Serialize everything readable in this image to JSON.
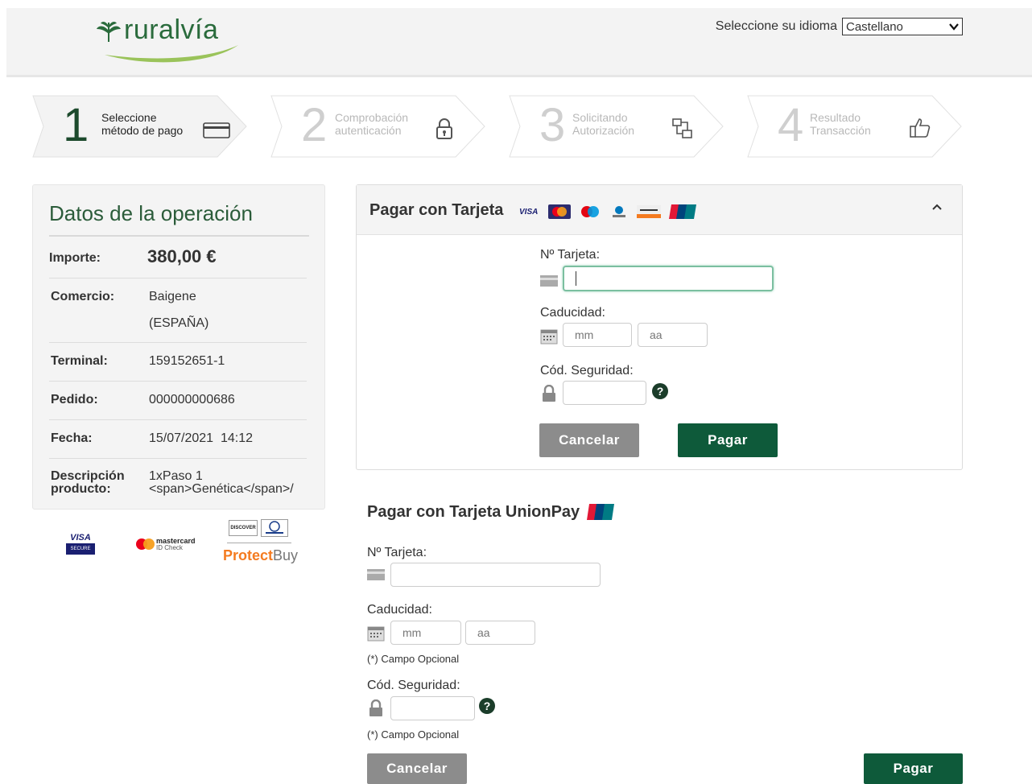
{
  "header": {
    "brand": "ruralvía",
    "language_label": "Seleccione su idioma",
    "language_selected": "Castellano"
  },
  "steps": [
    {
      "number": "1",
      "line1": "Seleccione",
      "line2": "método de pago",
      "icon": "credit-card-icon",
      "active": true
    },
    {
      "number": "2",
      "line1": "Comprobación",
      "line2": "autenticación",
      "icon": "lock-icon",
      "active": false
    },
    {
      "number": "3",
      "line1": "Solicitando",
      "line2": "Autorización",
      "icon": "network-icon",
      "active": false
    },
    {
      "number": "4",
      "line1": "Resultado",
      "line2": "Transacción",
      "icon": "thumbs-up-icon",
      "active": false
    }
  ],
  "operation": {
    "title": "Datos de la operación",
    "importe_label": "Importe:",
    "importe_value": "380,00 €",
    "comercio_label": "Comercio:",
    "comercio_value_1": "Baigene",
    "comercio_value_2": "(ESPAÑA)",
    "terminal_label": "Terminal:",
    "terminal_value": "159152651-1",
    "pedido_label": "Pedido:",
    "pedido_value": "000000000686",
    "fecha_label": "Fecha:",
    "fecha_value": "15/07/2021  14:12",
    "descripcion_label_1": "Descripción",
    "descripcion_label_2": "producto:",
    "descripcion_value_1": "1xPaso 1",
    "descripcion_value_2": "<span>Genética</span>/"
  },
  "brand_logos": {
    "visa": "VISA",
    "visa_sub": "SECURE",
    "mastercard": "mastercard",
    "mastercard_sub": "ID Check",
    "discover": "DISCOVER",
    "protectbuy_1": "Protect",
    "protectbuy_2": "Buy"
  },
  "card_form": {
    "title": "Pagar con Tarjeta",
    "card_logo_visa": "VISA",
    "card_number_label": "Nº Tarjeta:",
    "expiry_label": "Caducidad:",
    "month_placeholder": "mm",
    "year_placeholder": "aa",
    "cvv_label": "Cód. Seguridad:",
    "help": "?",
    "cancel": "Cancelar",
    "pay": "Pagar"
  },
  "unionpay_form": {
    "title": "Pagar con Tarjeta UnionPay",
    "card_number_label": "Nº Tarjeta:",
    "expiry_label": "Caducidad:",
    "month_placeholder": "mm",
    "year_placeholder": "aa",
    "optional_note_1": "(*) Campo Opcional",
    "cvv_label": "Cód. Seguridad:",
    "help": "?",
    "optional_note_2": "(*) Campo Opcional",
    "cancel": "Cancelar",
    "pay": "Pagar"
  },
  "colors": {
    "brand_green": "#0e5a3a",
    "title_green": "#2b5c3a",
    "cancel_grey": "#8c8c8c"
  }
}
